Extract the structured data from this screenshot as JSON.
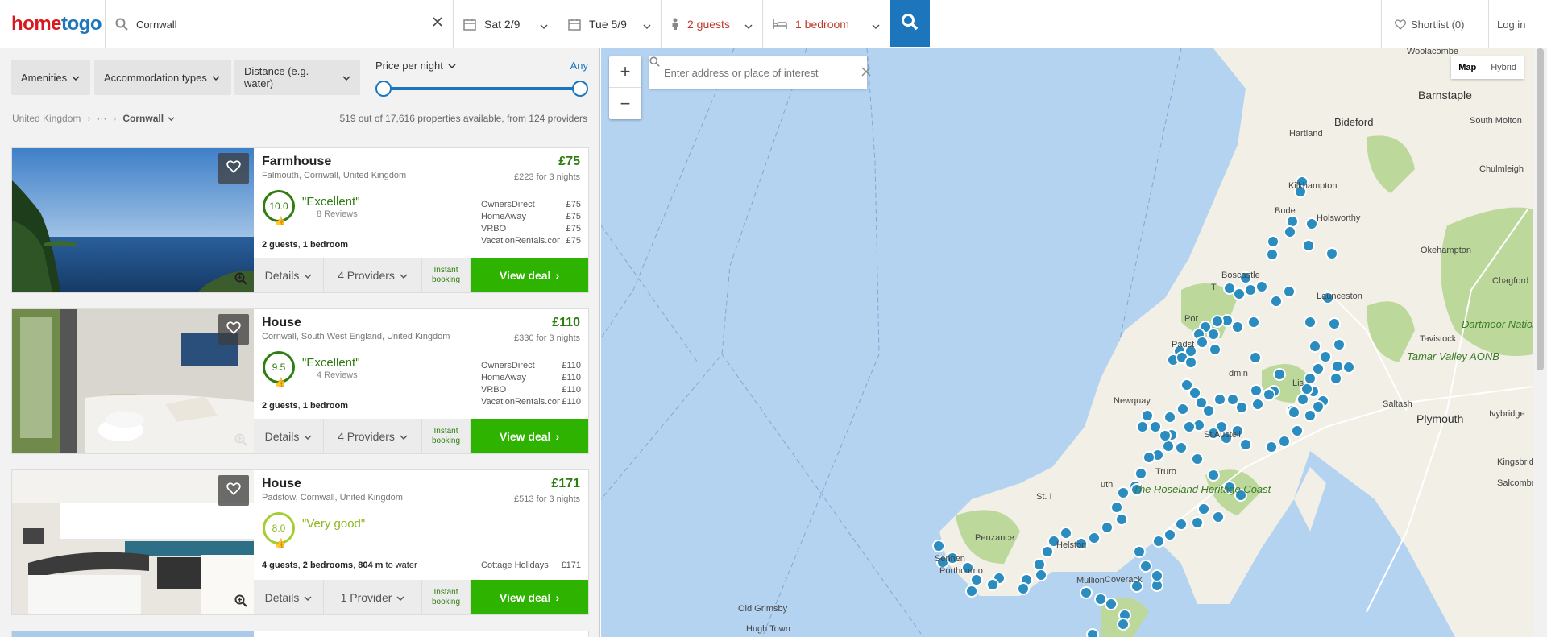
{
  "header": {
    "logo_part1": "home",
    "logo_part2": "togo",
    "search_value": "Cornwall",
    "checkin": "Sat 2/9",
    "checkout": "Tue 5/9",
    "guests": "2 guests",
    "bedrooms": "1 bedroom",
    "shortlist": "Shortlist (0)",
    "login": "Log in"
  },
  "filters": {
    "amenities": "Amenities",
    "accommodation": "Accommodation types",
    "distance": "Distance (e.g. water)",
    "price_label": "Price per night",
    "price_any": "Any"
  },
  "breadcrumb": {
    "country": "United Kingdom",
    "ellipsis": "···",
    "current": "Cornwall"
  },
  "availability": "519 out of 17,616 properties available, from 124 providers",
  "listings": [
    {
      "name": "Farmhouse",
      "location": "Falmouth, Cornwall, United Kingdom",
      "price": "£75",
      "total": "£223 for 3 nights",
      "score": "10.0",
      "rating_label": "\"Excellent\"",
      "reviews": "8 Reviews",
      "specs_guests": "2 guests",
      "specs_bedrooms": "1 bedroom",
      "specs_extra": "",
      "providers": [
        {
          "name": "OwnersDirect",
          "price": "£75"
        },
        {
          "name": "HomeAway",
          "price": "£75"
        },
        {
          "name": "VRBO",
          "price": "£75"
        },
        {
          "name": "VacationRentals.com",
          "price": "£75"
        }
      ],
      "details": "Details",
      "providers_btn": "4 Providers",
      "instant": "Instant booking",
      "view_deal": "View deal"
    },
    {
      "name": "House",
      "location": "Cornwall, South West England, United Kingdom",
      "price": "£110",
      "total": "£330 for 3 nights",
      "score": "9.5",
      "rating_label": "\"Excellent\"",
      "reviews": "4 Reviews",
      "specs_guests": "2 guests",
      "specs_bedrooms": "1 bedroom",
      "specs_extra": "",
      "providers": [
        {
          "name": "OwnersDirect",
          "price": "£110"
        },
        {
          "name": "HomeAway",
          "price": "£110"
        },
        {
          "name": "VRBO",
          "price": "£110"
        },
        {
          "name": "VacationRentals.com",
          "price": "£110"
        }
      ],
      "details": "Details",
      "providers_btn": "4 Providers",
      "instant": "Instant booking",
      "view_deal": "View deal"
    },
    {
      "name": "House",
      "location": "Padstow, Cornwall, United Kingdom",
      "price": "£171",
      "total": "£513 for 3 nights",
      "score": "8.0",
      "rating_label": "\"Very good\"",
      "reviews": "",
      "specs_guests": "4 guests",
      "specs_bedrooms": "2 bedrooms",
      "specs_extra": "804 m",
      "specs_extra_suffix": " to water",
      "providers": [
        {
          "name": "Cottage Holidays",
          "price": "£171"
        }
      ],
      "details": "Details",
      "providers_btn": "1 Provider",
      "instant": "Instant booking",
      "view_deal": "View deal"
    }
  ],
  "map": {
    "search_placeholder": "Enter address or place of interest",
    "type_map": "Map",
    "type_hybrid": "Hybrid",
    "zoom_in": "+",
    "zoom_out": "−",
    "places": {
      "woolacombe": "Woolacombe",
      "barnstaple": "Barnstaple",
      "bideford": "Bideford",
      "south_molton": "South Molton",
      "hartland": "Hartland",
      "chulmleigh": "Chulmleigh",
      "kilkhampton": "Kilkhampton",
      "bude": "Bude",
      "holsworthy": "Holsworthy",
      "okehampton": "Okehampton",
      "chagford": "Chagford",
      "boscastle": "Boscastle",
      "tintagel": "Ti",
      "launceston": "Launceston",
      "dartmoor": "Dartmoor National Park",
      "tavistock": "Tavistock",
      "port_isaac": "Por",
      "padstow": "Padst",
      "bodmin": "dmin",
      "tamar": "Tamar Valley AONB",
      "liskeard": "Lis",
      "newquay": "Newquay",
      "saltash": "Saltash",
      "plymouth": "Plymouth",
      "ivybridge": "Ivybridge",
      "st_austell": "St Austell",
      "truro": "Truro",
      "kingsbridge": "Kingsbridge",
      "roseland": "The Roseland Heritage Coast",
      "st_ives": "St. I",
      "salcombe": "Salcombe",
      "penzance": "Penzance",
      "helston": "Helston",
      "sennen": "Sennen",
      "porthcurno": "Porthcurno",
      "coverack": "Coverack",
      "mullion": "Mullion",
      "falmouth": "uth",
      "old_grimsby": "Old Grimsby",
      "hugh_town": "Hugh Town"
    }
  },
  "colors": {
    "brand_red": "#d71920",
    "brand_blue": "#1d76bb",
    "deal_green": "#2db300",
    "rating_green": "#2e7d0f",
    "sea": "#b4d3f1",
    "land": "#f2efe6",
    "park": "#bcd89a",
    "pin": "#2b8cc0"
  }
}
